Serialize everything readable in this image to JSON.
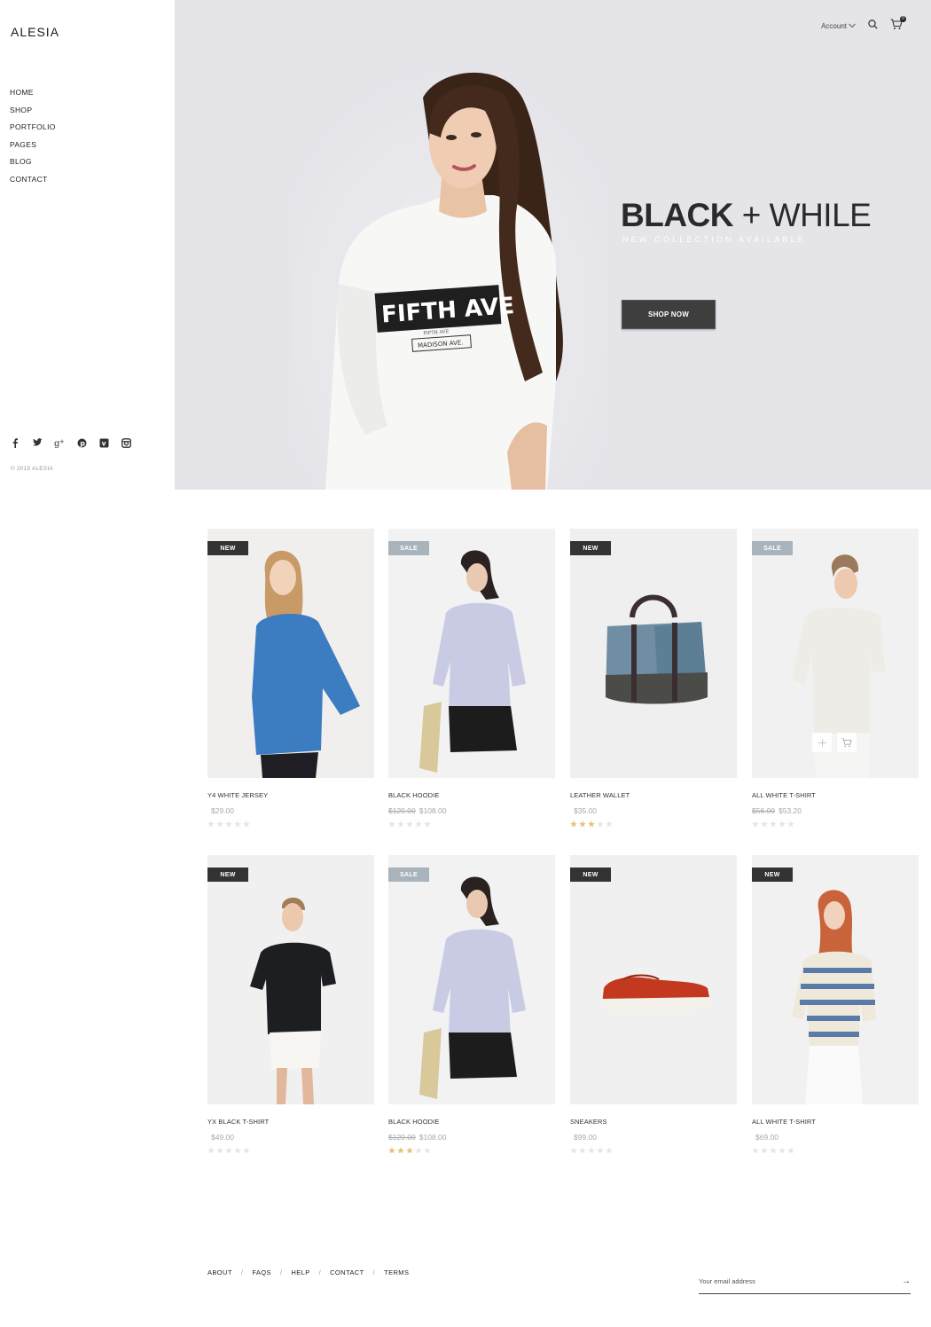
{
  "brand": "ALESIA",
  "nav": [
    "HOME",
    "SHOP",
    "PORTFOLIO",
    "PAGES",
    "BLOG",
    "CONTACT"
  ],
  "social_icons": [
    "facebook-icon",
    "twitter-icon",
    "google-plus-icon",
    "pinterest-icon",
    "vimeo-icon",
    "instagram-icon"
  ],
  "copyright": "© 2015 ALESIA",
  "header": {
    "account_label": "Account",
    "cart_count": "0"
  },
  "hero": {
    "title_bold": "BLACK",
    "title_plus": "+",
    "title_light": "WHILE",
    "subtitle": "NEW COLLECTION AVAILABLE",
    "button_label": "SHOP NOW",
    "shirt_text": "FIFTH AVE",
    "shirt_sub": "FIFTH AVE",
    "shirt_sub2": "MADISON AVE."
  },
  "products": [
    {
      "badge": "NEW",
      "name": "Y4 WHITE JERSEY",
      "old_price": "",
      "price": "$29.00",
      "rating": 0
    },
    {
      "badge": "SALE",
      "name": "BLACK HOODIE",
      "old_price": "$120.00",
      "price": "$108.00",
      "rating": 0
    },
    {
      "badge": "NEW",
      "name": "LEATHER WALLET",
      "old_price": "",
      "price": "$35.00",
      "rating": 3
    },
    {
      "badge": "SALE",
      "name": "ALL WHITE T-SHIRT",
      "old_price": "$56.00",
      "price": "$53.20",
      "rating": 0
    },
    {
      "badge": "NEW",
      "name": "YX BLACK T-SHIRT",
      "old_price": "",
      "price": "$49.00",
      "rating": 0
    },
    {
      "badge": "SALE",
      "name": "BLACK HOODIE",
      "old_price": "$120.00",
      "price": "$108.00",
      "rating": 3
    },
    {
      "badge": "NEW",
      "name": "SNEAKERS",
      "old_price": "",
      "price": "$99.00",
      "rating": 0
    },
    {
      "badge": "NEW",
      "name": "ALL WHITE T-SHIRT",
      "old_price": "",
      "price": "$69.00",
      "rating": 0
    }
  ],
  "footer": {
    "links": [
      "ABOUT",
      "FAQS",
      "HELP",
      "CONTACT",
      "TERMS"
    ],
    "separator": "/",
    "email_placeholder": "Your email address",
    "submit_arrow": "→"
  },
  "colors": {
    "hero_bg": "#e4e4e9",
    "badge_new": "#333333",
    "badge_sale": "#a8b3bb",
    "star_on": "#e8c27a",
    "star_off": "#e6e6e6"
  }
}
